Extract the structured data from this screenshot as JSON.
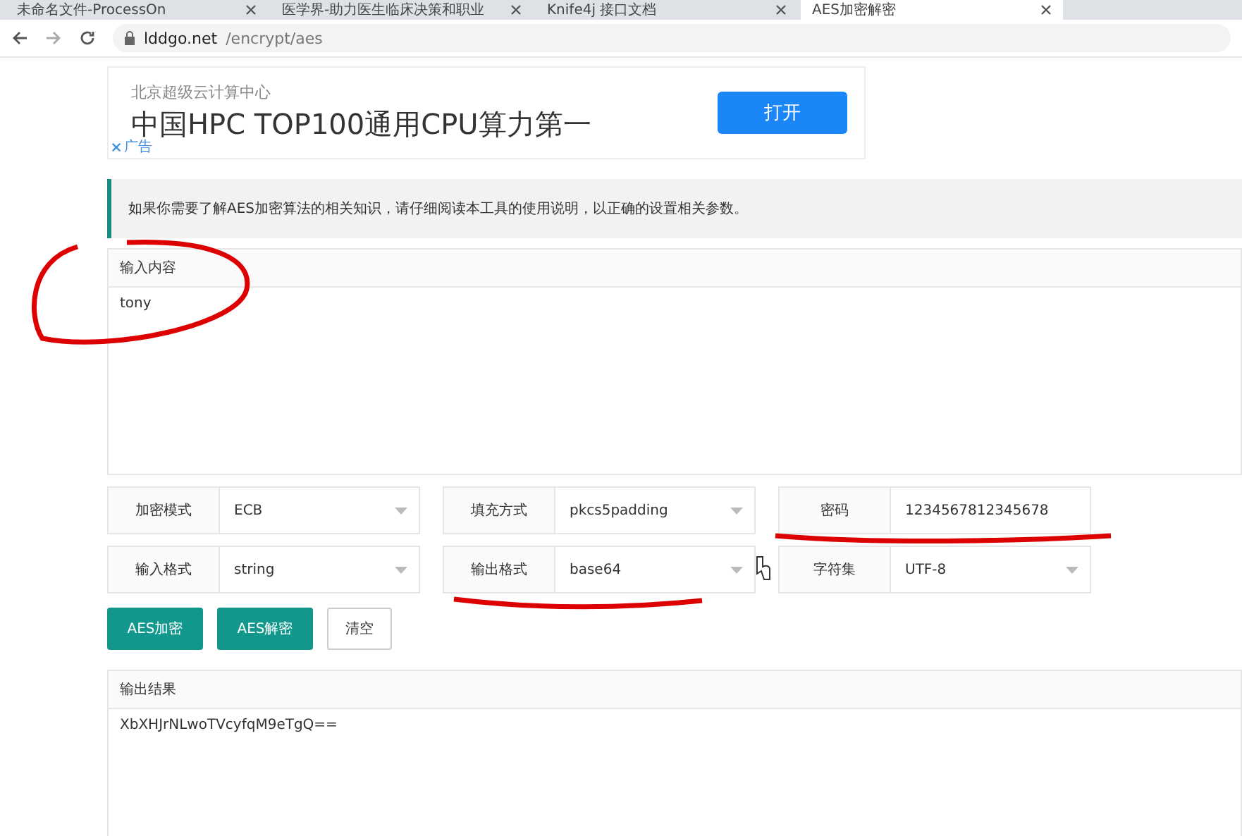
{
  "browser": {
    "tabs": [
      {
        "title": "未命名文件-ProcessOn",
        "selected": false
      },
      {
        "title": "医学界-助力医生临床决策和职业",
        "selected": false
      },
      {
        "title": "Knife4j 接口文档",
        "selected": false
      },
      {
        "title": "AES加密解密",
        "selected": true
      }
    ],
    "url_host": "lddgo.net",
    "url_path": "/encrypt/aes"
  },
  "ad": {
    "sponsor": "北京超级云计算中心",
    "headline": "中国HPC TOP100通用CPU算力第一",
    "button": "打开",
    "label": "广告"
  },
  "notice": "如果你需要了解AES加密算法的相关知识，请仔细阅读本工具的使用说明，以正确的设置相关参数。",
  "input": {
    "title": "输入内容",
    "value": "tony"
  },
  "options": [
    {
      "label": "加密模式",
      "value": "ECB",
      "kind": "select"
    },
    {
      "label": "填充方式",
      "value": "pkcs5padding",
      "kind": "select"
    },
    {
      "label": "密码",
      "value": "1234567812345678",
      "kind": "text"
    },
    {
      "label": "输入格式",
      "value": "string",
      "kind": "select"
    },
    {
      "label": "输出格式",
      "value": "base64",
      "kind": "select"
    },
    {
      "label": "字符集",
      "value": "UTF-8",
      "kind": "select"
    }
  ],
  "buttons": [
    {
      "label": "AES加密",
      "kind": "primary"
    },
    {
      "label": "AES解密",
      "kind": "primary"
    },
    {
      "label": "清空",
      "kind": "plain"
    }
  ],
  "output": {
    "title": "输出结果",
    "value": "XbXHJrNLwoTVcyfqM9eTgQ=="
  }
}
